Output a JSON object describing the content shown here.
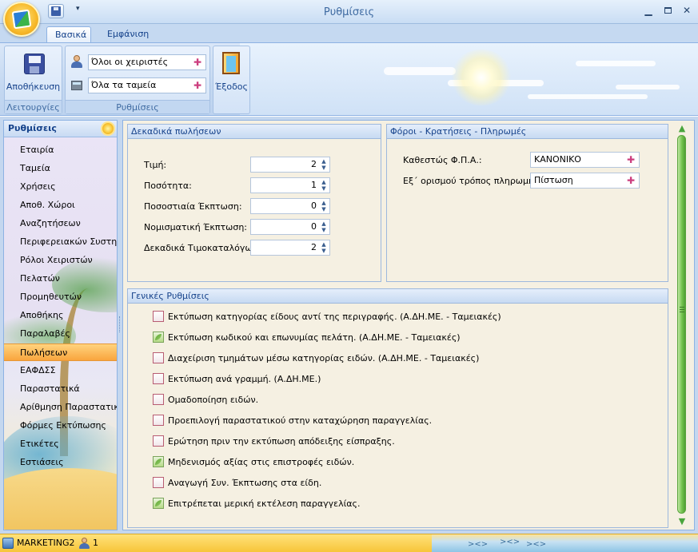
{
  "window": {
    "title": "Ρυθμίσεις"
  },
  "quick_access": {
    "menu_arrow": "▾"
  },
  "tabs": [
    {
      "label": "Βασικά",
      "active": true
    },
    {
      "label": "Εμφάνιση",
      "active": false
    }
  ],
  "ribbon": {
    "functions_group": {
      "label": "Λειτουργίες",
      "save_label": "Αποθήκευση"
    },
    "settings_group": {
      "label": "Ρυθμίσεις",
      "operators_value": "Όλοι οι χειριστές",
      "registers_value": "Όλα τα ταμεία"
    },
    "exit_label": "Έξοδος"
  },
  "nav": {
    "title": "Ρυθμίσεις",
    "items": [
      {
        "label": "Εταιρία"
      },
      {
        "label": "Ταμεία"
      },
      {
        "label": "Χρήσεις"
      },
      {
        "label": "Αποθ. Χώροι"
      },
      {
        "label": "Αναζητήσεων"
      },
      {
        "label": "Περιφερειακών Συστη..."
      },
      {
        "label": "Ρόλοι Χειριστών"
      },
      {
        "label": "Πελατών"
      },
      {
        "label": "Προμηθευτών"
      },
      {
        "label": "Αποθήκης"
      },
      {
        "label": "Παραλαβές"
      },
      {
        "label": "Πωλήσεων",
        "active": true
      },
      {
        "label": "ΕΑΦΔΣΣ"
      },
      {
        "label": "Παραστατικά"
      },
      {
        "label": "Αρίθμηση Παραστατικών"
      },
      {
        "label": "Φόρμες Εκτύπωσης"
      },
      {
        "label": "Ετικέτες"
      },
      {
        "label": "Εστιάσεις"
      }
    ]
  },
  "decimals": {
    "title": "Δεκαδικά πωλήσεων",
    "fields": [
      {
        "label": "Τιμή:",
        "value": "2"
      },
      {
        "label": "Ποσότητα:",
        "value": "1"
      },
      {
        "label": "Ποσοστιαία Έκπτωση:",
        "value": "0"
      },
      {
        "label": "Νομισματική Έκπτωση:",
        "value": "0"
      },
      {
        "label": "Δεκαδικά Τιμοκαταλόγων:",
        "value": "2"
      }
    ]
  },
  "taxes": {
    "title": "Φόροι - Κρατήσεις - Πληρωμές",
    "vat_label": "Καθεστώς Φ.Π.Α.:",
    "vat_value": "ΚΑΝΟΝΙΚΟ",
    "payment_label": "Εξ΄ ορισμού τρόπος πληρωμής:",
    "payment_value": "Πίστωση"
  },
  "general": {
    "title": "Γενικές Ρυθμίσεις",
    "options": [
      {
        "label": "Εκτύπωση κατηγορίας είδους αντί της περιγραφής. (Α.ΔΗ.ΜΕ. - Ταμειακές)",
        "checked": false
      },
      {
        "label": "Εκτύπωση κωδικού και επωνυμίας πελάτη. (Α.ΔΗ.ΜΕ. - Ταμειακές)",
        "checked": true
      },
      {
        "label": "Διαχείριση τμημάτων μέσω κατηγορίας ειδών. (Α.ΔΗ.ΜΕ. - Ταμειακές)",
        "checked": false
      },
      {
        "label": "Εκτύπωση ανά γραμμή. (Α.ΔΗ.ΜΕ.)",
        "checked": false
      },
      {
        "label": "Ομαδοποίηση ειδών.",
        "checked": false
      },
      {
        "label": "Προεπιλογή παραστατικού στην καταχώρηση παραγγελίας.",
        "checked": false
      },
      {
        "label": "Ερώτηση πριν την εκτύπωση απόδειξης είσπραξης.",
        "checked": false
      },
      {
        "label": "Μηδενισμός αξίας στις επιστροφές ειδών.",
        "checked": true
      },
      {
        "label": "Αναγωγή Συν. Έκπτωσης στα είδη.",
        "checked": false
      },
      {
        "label": "Επιτρέπεται μερική εκτέλεση παραγγελίας.",
        "checked": true
      }
    ]
  },
  "status": {
    "database": "MARKETING2",
    "users": "1"
  }
}
